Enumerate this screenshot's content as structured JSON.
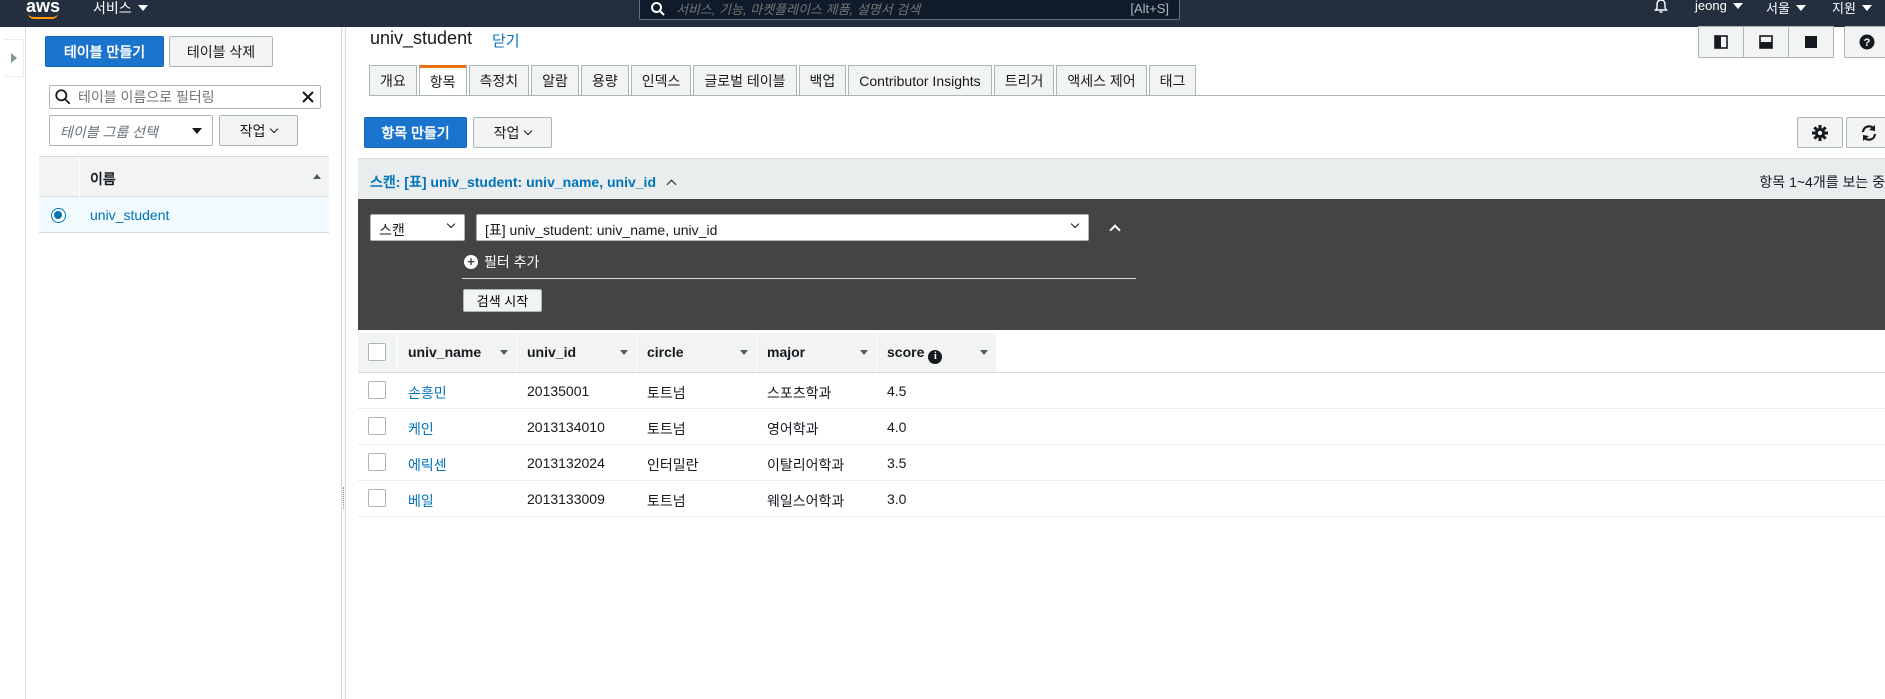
{
  "topnav": {
    "logo": "aws",
    "services_label": "서비스",
    "search_placeholder": "서비스, 기능, 마켓플레이스 제품, 설명서 검색",
    "search_hint": "[Alt+S]",
    "user": "jeong",
    "region": "서울",
    "support": "지원",
    "icons": [
      "search-icon",
      "bell-icon",
      "caret-down-icon"
    ]
  },
  "left_panel": {
    "create_table": "테이블 만들기",
    "delete_table": "테이블 삭제",
    "filter_placeholder": "테이블 이름으로 필터링",
    "group_select_placeholder": "테이블 그룹 선택",
    "actions_label": "작업",
    "column_name": "이름",
    "tables": [
      {
        "name": "univ_student",
        "selected": true
      }
    ]
  },
  "main": {
    "table_title": "univ_student",
    "close_label": "닫기",
    "tabs": [
      {
        "label": "개요",
        "active": false
      },
      {
        "label": "항목",
        "active": true
      },
      {
        "label": "측정치",
        "active": false
      },
      {
        "label": "알람",
        "active": false
      },
      {
        "label": "용량",
        "active": false
      },
      {
        "label": "인덱스",
        "active": false
      },
      {
        "label": "글로벌 테이블",
        "active": false
      },
      {
        "label": "백업",
        "active": false
      },
      {
        "label": "Contributor Insights",
        "active": false
      },
      {
        "label": "트리거",
        "active": false
      },
      {
        "label": "액세스 제어",
        "active": false
      },
      {
        "label": "태그",
        "active": false
      }
    ],
    "create_item": "항목 만들기",
    "actions_label": "작업",
    "scan_summary": "스캔: [표] univ_student: univ_name, univ_id",
    "items_count": "항목 1~4개를 보는 중",
    "scan_panel": {
      "mode_value": "스캔",
      "target_value": "[표] univ_student: univ_name, univ_id",
      "add_filter": "필터 추가",
      "start_search": "검색 시작"
    },
    "columns": [
      "univ_name",
      "univ_id",
      "circle",
      "major",
      "score"
    ],
    "rows": [
      {
        "univ_name": "손흥민",
        "univ_id": "20135001",
        "circle": "토트넘",
        "major": "스포츠학과",
        "score": "4.5"
      },
      {
        "univ_name": "케인",
        "univ_id": "2013134010",
        "circle": "토트넘",
        "major": "영어학과",
        "score": "4.0"
      },
      {
        "univ_name": "에릭센",
        "univ_id": "2013132024",
        "circle": "인터밀란",
        "major": "이탈리어학과",
        "score": "3.5"
      },
      {
        "univ_name": "베일",
        "univ_id": "2013133009",
        "circle": "토트넘",
        "major": "웨일스어학과",
        "score": "3.0"
      }
    ]
  },
  "colors": {
    "nav_bg": "#232f3e",
    "primary": "#1a73cc",
    "link": "#0073bb",
    "active_tab": "#ec7211",
    "scan_panel_bg": "#444444"
  }
}
